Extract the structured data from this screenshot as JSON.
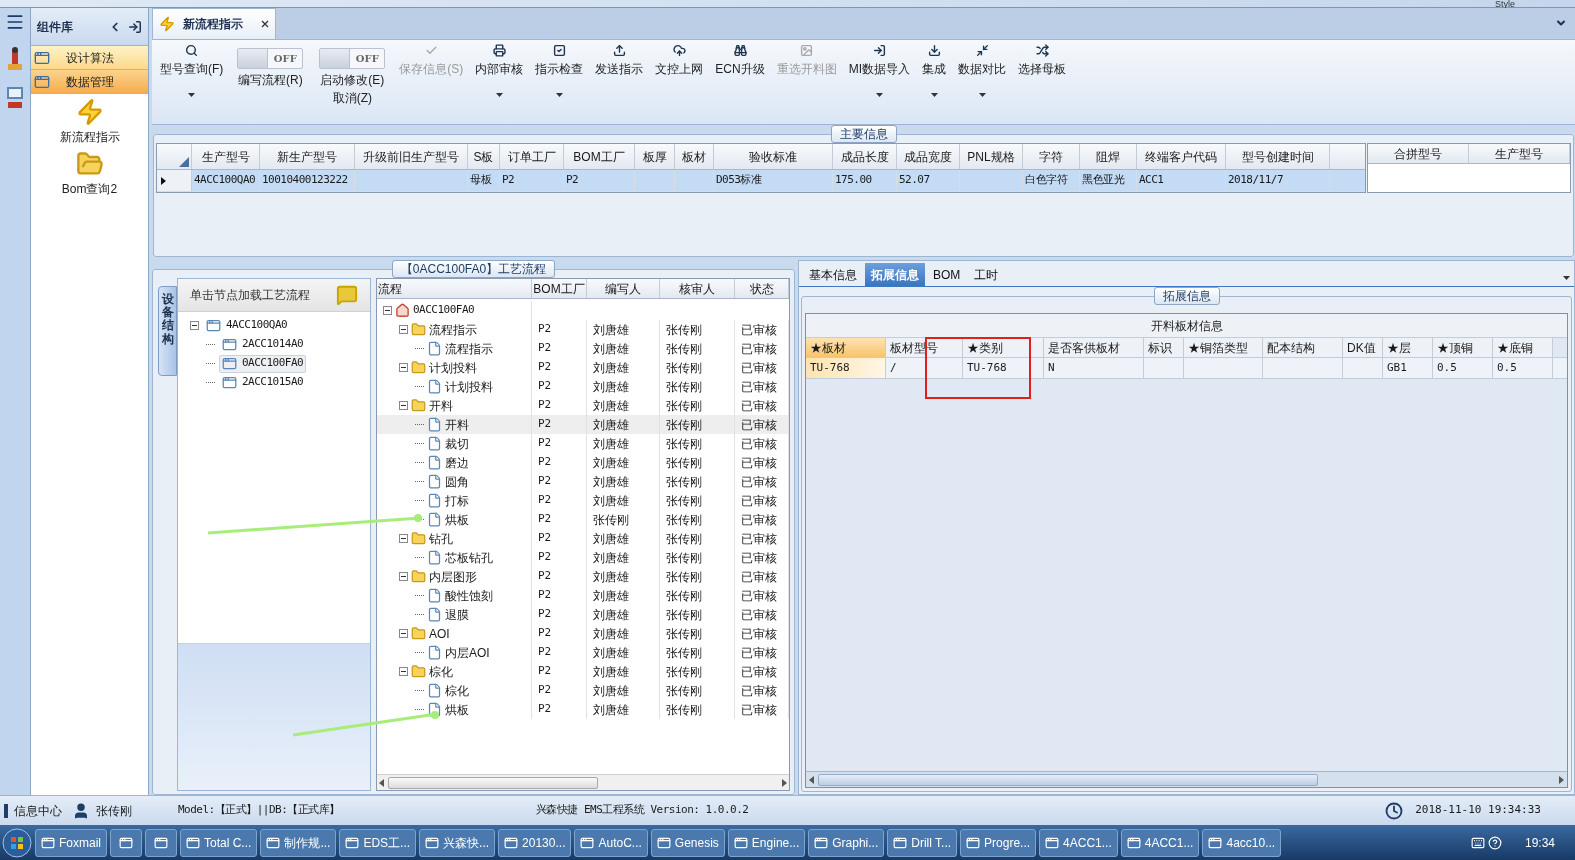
{
  "top_bar": {
    "style_menu": "Style"
  },
  "sidebar": {
    "title": "组件库",
    "groups": [
      {
        "label": "设计算法",
        "selected": false
      },
      {
        "label": "数据管理",
        "selected": true
      }
    ],
    "tiles": [
      {
        "label": "新流程指示"
      },
      {
        "label": "Bom查询2"
      }
    ]
  },
  "doc_tab": {
    "title": "新流程指示"
  },
  "toolbar": [
    {
      "kind": "button",
      "label": "型号查询(F)",
      "dropdown": true,
      "disabled": false
    },
    {
      "kind": "toggle",
      "toggle_text": "OFF",
      "on": false,
      "label": "编写流程(R)"
    },
    {
      "kind": "toggle",
      "toggle_text": "OFF",
      "on": false,
      "label": "启动修改(E)",
      "sub_label": "取消(Z)"
    },
    {
      "kind": "button",
      "label": "保存信息(S)",
      "dropdown": false,
      "disabled": true
    },
    {
      "kind": "button",
      "label": "内部审核",
      "dropdown": true,
      "disabled": false
    },
    {
      "kind": "button",
      "label": "指示检查",
      "dropdown": true,
      "disabled": false
    },
    {
      "kind": "button",
      "label": "发送指示",
      "dropdown": false,
      "disabled": false
    },
    {
      "kind": "button",
      "label": "文控上网",
      "dropdown": false,
      "disabled": false
    },
    {
      "kind": "button",
      "label": "ECN升级",
      "dropdown": false,
      "disabled": false
    },
    {
      "kind": "button",
      "label": "重选开料图",
      "dropdown": false,
      "disabled": true
    },
    {
      "kind": "button",
      "label": "MI数据导入",
      "dropdown": true,
      "disabled": false
    },
    {
      "kind": "button",
      "label": "集成",
      "dropdown": true,
      "disabled": false
    },
    {
      "kind": "button",
      "label": "数据对比",
      "dropdown": true,
      "disabled": false
    },
    {
      "kind": "button",
      "label": "选择母板",
      "dropdown": false,
      "disabled": false
    }
  ],
  "main_info": {
    "title": "主要信息",
    "columns": [
      "生产型号",
      "新生产型号",
      "升级前旧生产型号",
      "S板",
      "订单工厂",
      "BOM工厂",
      "板厚",
      "板材",
      "验收标准",
      "成品长度",
      "成品宽度",
      "PNL规格",
      "字符",
      "阻焊",
      "终端客户代码",
      "型号创建时间"
    ],
    "rows": [
      {
        "selected": true,
        "cells": [
          "4ACC100QA0",
          "10010400123222",
          null,
          "母板",
          "P2",
          "P2",
          null,
          null,
          "D053标准",
          "175.00",
          "52.07",
          null,
          "白色字符",
          "黑色亚光",
          "ACC1",
          "2018/11/7"
        ]
      }
    ],
    "side_columns": [
      "合拼型号",
      "生产型号"
    ]
  },
  "process": {
    "title": "【0ACC100FA0】工艺流程",
    "side_tab": "设备结构",
    "hint": "单击节点加载工艺流程",
    "structure": [
      {
        "label": "4ACC100QA0",
        "expanded": true,
        "selected": false,
        "children": [
          {
            "label": "2ACC1014A0",
            "selected": false
          },
          {
            "label": "0ACC100FA0",
            "selected": true
          },
          {
            "label": "2ACC1015A0",
            "selected": false
          }
        ]
      }
    ],
    "columns": [
      "流程",
      "BOM工厂",
      "编写人",
      "核审人",
      "状态"
    ],
    "flow": [
      {
        "kind": "root",
        "label": "0ACC100FA0",
        "expanded": true,
        "selected": false,
        "children": [
          {
            "kind": "group",
            "label": "流程指示",
            "cells": [
              "P2",
              "刘唐雄",
              "张传刚",
              "已审核"
            ],
            "expanded": true,
            "selected": false,
            "children": [
              {
                "kind": "step",
                "label": "流程指示",
                "cells": [
                  "P2",
                  "刘唐雄",
                  "张传刚",
                  "已审核"
                ],
                "selected": false
              }
            ]
          },
          {
            "kind": "group",
            "label": "计划投料",
            "cells": [
              "P2",
              "刘唐雄",
              "张传刚",
              "已审核"
            ],
            "expanded": true,
            "selected": false,
            "children": [
              {
                "kind": "step",
                "label": "计划投料",
                "cells": [
                  "P2",
                  "刘唐雄",
                  "张传刚",
                  "已审核"
                ],
                "selected": false
              }
            ]
          },
          {
            "kind": "group",
            "label": "开料",
            "cells": [
              "P2",
              "刘唐雄",
              "张传刚",
              "已审核"
            ],
            "expanded": true,
            "selected": false,
            "children": [
              {
                "kind": "step",
                "label": "开料",
                "cells": [
                  "P2",
                  "刘唐雄",
                  "张传刚",
                  "已审核"
                ],
                "selected": true
              },
              {
                "kind": "step",
                "label": "裁切",
                "cells": [
                  "P2",
                  "刘唐雄",
                  "张传刚",
                  "已审核"
                ],
                "selected": false
              },
              {
                "kind": "step",
                "label": "磨边",
                "cells": [
                  "P2",
                  "刘唐雄",
                  "张传刚",
                  "已审核"
                ],
                "selected": false
              },
              {
                "kind": "step",
                "label": "圆角",
                "cells": [
                  "P2",
                  "刘唐雄",
                  "张传刚",
                  "已审核"
                ],
                "selected": false
              },
              {
                "kind": "step",
                "label": "打标",
                "cells": [
                  "P2",
                  "刘唐雄",
                  "张传刚",
                  "已审核"
                ],
                "selected": false
              },
              {
                "kind": "step",
                "label": "烘板",
                "cells": [
                  "P2",
                  "张传刚",
                  "张传刚",
                  "已审核"
                ],
                "selected": false
              }
            ]
          },
          {
            "kind": "group",
            "label": "钻孔",
            "cells": [
              "P2",
              "刘唐雄",
              "张传刚",
              "已审核"
            ],
            "expanded": true,
            "selected": false,
            "children": [
              {
                "kind": "step",
                "label": "芯板钻孔",
                "cells": [
                  "P2",
                  "刘唐雄",
                  "张传刚",
                  "已审核"
                ],
                "selected": false
              }
            ]
          },
          {
            "kind": "group",
            "label": "内层图形",
            "cells": [
              "P2",
              "刘唐雄",
              "张传刚",
              "已审核"
            ],
            "expanded": true,
            "selected": false,
            "children": [
              {
                "kind": "step",
                "label": "酸性蚀刻",
                "cells": [
                  "P2",
                  "刘唐雄",
                  "张传刚",
                  "已审核"
                ],
                "selected": false
              },
              {
                "kind": "step",
                "label": "退膜",
                "cells": [
                  "P2",
                  "刘唐雄",
                  "张传刚",
                  "已审核"
                ],
                "selected": false
              }
            ]
          },
          {
            "kind": "group",
            "label": "AOI",
            "cells": [
              "P2",
              "刘唐雄",
              "张传刚",
              "已审核"
            ],
            "expanded": true,
            "selected": false,
            "children": [
              {
                "kind": "step",
                "label": "内层AOI",
                "cells": [
                  "P2",
                  "刘唐雄",
                  "张传刚",
                  "已审核"
                ],
                "selected": false
              }
            ]
          },
          {
            "kind": "group",
            "label": "棕化",
            "cells": [
              "P2",
              "刘唐雄",
              "张传刚",
              "已审核"
            ],
            "expanded": true,
            "selected": false,
            "children": [
              {
                "kind": "step",
                "label": "棕化",
                "cells": [
                  "P2",
                  "刘唐雄",
                  "张传刚",
                  "已审核"
                ],
                "selected": false
              },
              {
                "kind": "step",
                "label": "烘板",
                "cells": [
                  "P2",
                  "刘唐雄",
                  "张传刚",
                  "已审核"
                ],
                "selected": false
              }
            ]
          }
        ]
      }
    ]
  },
  "detail": {
    "tabs": [
      {
        "label": "基本信息",
        "selected": false
      },
      {
        "label": "拓展信息",
        "selected": true
      },
      {
        "label": "BOM",
        "selected": false
      },
      {
        "label": "工时",
        "selected": false
      }
    ],
    "section": "拓展信息",
    "table_title": "开料板材信息",
    "columns": [
      "★板材",
      "板材型号",
      "★类别",
      "是否客供板材",
      "标识",
      "★铜箔类型",
      "配本结构",
      "DK值",
      "★层",
      "★顶铜",
      "★底铜"
    ],
    "rows": [
      {
        "selected": true,
        "cells": [
          "TU-768",
          "/",
          "TU-768",
          "N",
          null,
          null,
          null,
          null,
          "GB1",
          "0.5",
          "0.5"
        ]
      }
    ]
  },
  "status_bar": {
    "info_center": "信息中心",
    "user": "张传刚",
    "model": "Model:【正式】||DB:【正式库】",
    "system": "兴森快捷 EMS工程系统 Version: 1.0.0.2",
    "datetime": "2018-11-10 19:34:33"
  },
  "taskbar": {
    "items": [
      {
        "kind": "app",
        "label": "Foxmail"
      },
      {
        "kind": "icon"
      },
      {
        "kind": "icon"
      },
      {
        "kind": "app",
        "label": "Total C..."
      },
      {
        "kind": "app",
        "label": "制作规..."
      },
      {
        "kind": "app",
        "label": "EDS工..."
      },
      {
        "kind": "app",
        "label": "兴森快..."
      },
      {
        "kind": "app",
        "label": "20130..."
      },
      {
        "kind": "app",
        "label": "AutoC..."
      },
      {
        "kind": "app",
        "label": "Genesis"
      },
      {
        "kind": "app",
        "label": "Engine..."
      },
      {
        "kind": "app",
        "label": "Graphi..."
      },
      {
        "kind": "app",
        "label": "Drill T..."
      },
      {
        "kind": "app",
        "label": "Progre..."
      },
      {
        "kind": "app",
        "label": "4ACC1..."
      },
      {
        "kind": "app",
        "label": "4ACC1..."
      },
      {
        "kind": "app",
        "label": "4acc10..."
      }
    ],
    "clock": "19:34"
  }
}
